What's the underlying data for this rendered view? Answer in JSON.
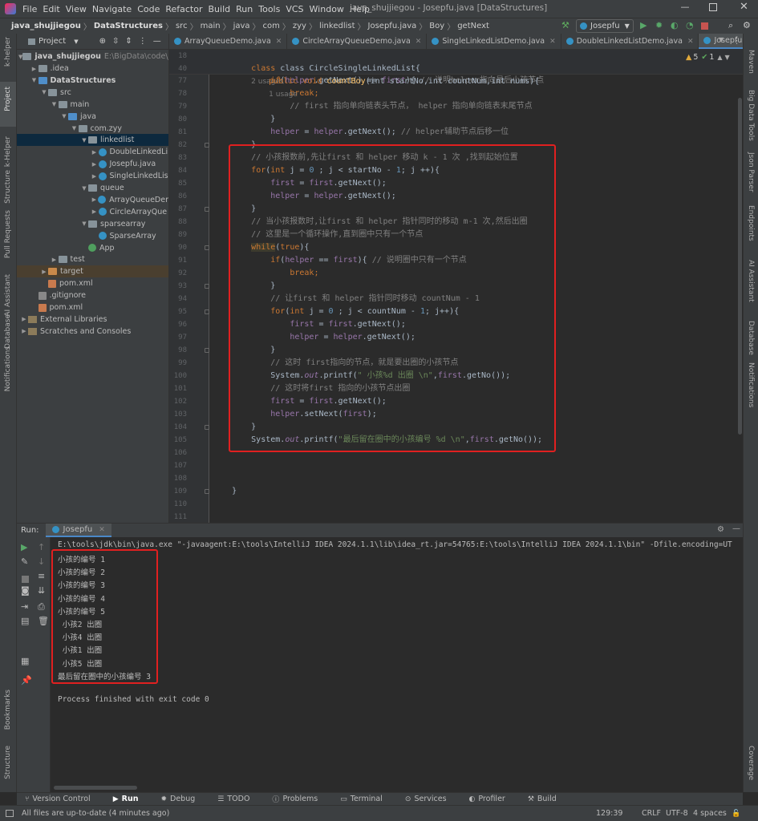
{
  "title_bar": {
    "menus": [
      "File",
      "Edit",
      "View",
      "Navigate",
      "Code",
      "Refactor",
      "Build",
      "Run",
      "Tools",
      "VCS",
      "Window",
      "Help"
    ],
    "title": "java_shujjiegou - Josepfu.java [DataStructures]"
  },
  "breadcrumb": [
    "java_shujjiegou",
    "DataStructures",
    "src",
    "main",
    "java",
    "com",
    "zyy",
    "linkedlist",
    "Josepfu.java",
    "Boy",
    "getNext"
  ],
  "run_config": "Josepfu",
  "left_strip": {
    "items": [
      "k-helper",
      "Project",
      "k-Helper",
      "Structure",
      "Pull Requests",
      "AI Assistant",
      "Database",
      "Notifications",
      "Bookmarks",
      "Structure"
    ]
  },
  "right_strip": {
    "items": [
      "Maven",
      "Big Data Tools",
      "Json Parser",
      "Endpoints",
      "AI Assistant",
      "Database",
      "Notifications",
      "Coverage"
    ]
  },
  "project_panel": {
    "title": "Project",
    "root": "java_shujjiegou",
    "root_path": "E:\\BigData\\code\\java",
    "tree": [
      {
        "label": ".idea",
        "depth": 1,
        "icon": "folder",
        "arrow": ">"
      },
      {
        "label": "DataStructures",
        "depth": 1,
        "icon": "folder-blue",
        "arrow": "v",
        "bold": true
      },
      {
        "label": "src",
        "depth": 2,
        "icon": "folder",
        "arrow": "v"
      },
      {
        "label": "main",
        "depth": 3,
        "icon": "folder",
        "arrow": "v"
      },
      {
        "label": "java",
        "depth": 4,
        "icon": "folder-blue",
        "arrow": "v"
      },
      {
        "label": "com.zyy",
        "depth": 5,
        "icon": "folder",
        "arrow": "v"
      },
      {
        "label": "linkedlist",
        "depth": 6,
        "icon": "folder",
        "arrow": "v",
        "selected": true
      },
      {
        "label": "DoubleLinkedLi",
        "depth": 7,
        "icon": "class",
        "arrow": ">"
      },
      {
        "label": "Josepfu.java",
        "depth": 7,
        "icon": "class",
        "arrow": ">"
      },
      {
        "label": "SingleLinkedLis",
        "depth": 7,
        "icon": "class",
        "arrow": ">"
      },
      {
        "label": "queue",
        "depth": 6,
        "icon": "folder",
        "arrow": "v"
      },
      {
        "label": "ArrayQueueDer",
        "depth": 7,
        "icon": "class",
        "arrow": ">"
      },
      {
        "label": "CircleArrayQue",
        "depth": 7,
        "icon": "class",
        "arrow": ">"
      },
      {
        "label": "sparsearray",
        "depth": 6,
        "icon": "folder",
        "arrow": "v"
      },
      {
        "label": "SparseArray",
        "depth": 7,
        "icon": "class",
        "arrow": ""
      },
      {
        "label": "App",
        "depth": 6,
        "icon": "class-green",
        "arrow": ""
      },
      {
        "label": "test",
        "depth": 3,
        "icon": "folder",
        "arrow": ">"
      },
      {
        "label": "target",
        "depth": 2,
        "icon": "folder-orange",
        "arrow": ">",
        "highlight": true
      },
      {
        "label": "pom.xml",
        "depth": 2,
        "icon": "xml",
        "arrow": ""
      },
      {
        "label": ".gitignore",
        "depth": 1,
        "icon": "git",
        "arrow": ""
      },
      {
        "label": "pom.xml",
        "depth": 1,
        "icon": "xml",
        "arrow": ""
      },
      {
        "label": "External Libraries",
        "depth": 0,
        "icon": "lib",
        "arrow": ">"
      },
      {
        "label": "Scratches and Consoles",
        "depth": 0,
        "icon": "scratch",
        "arrow": ">"
      }
    ]
  },
  "editor_tabs": [
    {
      "label": "ArrayQueueDemo.java"
    },
    {
      "label": "CircleArrayQueueDemo.java"
    },
    {
      "label": "SingleLinkedListDemo.java"
    },
    {
      "label": "DoubleLinkedListDemo.java"
    },
    {
      "label": "Josepfu.java",
      "active": true
    }
  ],
  "inspections": {
    "warnings": "5",
    "weak": "1"
  },
  "code": {
    "sticky1": {
      "ln": "18",
      "text": "class CircleSingleLinkedList{",
      "hint": "2 usages"
    },
    "sticky2": {
      "ln": "40",
      "kw1": "public void ",
      "name": "countBoy",
      "params": "(int startNo,int countNum,int nums){",
      "hint": "1 usage"
    },
    "lines": [
      {
        "ln": "77",
        "tokens": [
          {
            "t": "            ",
            "c": ""
          },
          {
            "t": "if",
            "c": "kw"
          },
          {
            "t": "(",
            "c": ""
          },
          {
            "t": "helper",
            "c": "fld"
          },
          {
            "t": ".getNext() == ",
            "c": ""
          },
          {
            "t": "first",
            "c": "fld"
          },
          {
            "t": "){ ",
            "c": ""
          },
          {
            "t": "// 说明helper指向最后小孩节点",
            "c": "cm"
          }
        ]
      },
      {
        "ln": "78",
        "tokens": [
          {
            "t": "                ",
            "c": ""
          },
          {
            "t": "break",
            "c": "kw"
          },
          {
            "t": ";",
            "c": "kw"
          }
        ]
      },
      {
        "ln": "79",
        "tokens": [
          {
            "t": "                ",
            "c": ""
          },
          {
            "t": "// first 指向单向链表头节点， helper 指向单向链表末尾节点",
            "c": "cm"
          }
        ]
      },
      {
        "ln": "80",
        "tokens": [
          {
            "t": "            }",
            "c": ""
          }
        ]
      },
      {
        "ln": "81",
        "tokens": [
          {
            "t": "            ",
            "c": ""
          },
          {
            "t": "helper",
            "c": "fld"
          },
          {
            "t": " = ",
            "c": ""
          },
          {
            "t": "helper",
            "c": "fld"
          },
          {
            "t": ".getNext(); ",
            "c": ""
          },
          {
            "t": "// helper辅助节点后移一位",
            "c": "cm"
          }
        ]
      },
      {
        "ln": "82",
        "tokens": [
          {
            "t": "        }",
            "c": ""
          }
        ]
      },
      {
        "ln": "83",
        "tokens": [
          {
            "t": "        ",
            "c": ""
          },
          {
            "t": "// 小孩报数前,先让first 和 helper 移动 k - 1 次 ,找到起始位置",
            "c": "cm"
          }
        ]
      },
      {
        "ln": "84",
        "tokens": [
          {
            "t": "        ",
            "c": ""
          },
          {
            "t": "for",
            "c": "kw"
          },
          {
            "t": "(",
            "c": ""
          },
          {
            "t": "int ",
            "c": "kw"
          },
          {
            "t": "j = ",
            "c": ""
          },
          {
            "t": "0",
            "c": "num"
          },
          {
            "t": " ; j < startNo - ",
            "c": ""
          },
          {
            "t": "1",
            "c": "num"
          },
          {
            "t": "; j ++){",
            "c": ""
          }
        ]
      },
      {
        "ln": "85",
        "tokens": [
          {
            "t": "            ",
            "c": ""
          },
          {
            "t": "first",
            "c": "fld"
          },
          {
            "t": " = ",
            "c": ""
          },
          {
            "t": "first",
            "c": "fld"
          },
          {
            "t": ".getNext();",
            "c": ""
          }
        ]
      },
      {
        "ln": "86",
        "tokens": [
          {
            "t": "            ",
            "c": ""
          },
          {
            "t": "helper",
            "c": "fld"
          },
          {
            "t": " = ",
            "c": ""
          },
          {
            "t": "helper",
            "c": "fld"
          },
          {
            "t": ".getNext();",
            "c": ""
          }
        ]
      },
      {
        "ln": "87",
        "tokens": [
          {
            "t": "        }",
            "c": ""
          }
        ]
      },
      {
        "ln": "88",
        "tokens": [
          {
            "t": "        ",
            "c": ""
          },
          {
            "t": "// 当小孩报数时,让first 和 helper 指针同时的移动 m-1 次,然后出圈",
            "c": "cm"
          }
        ]
      },
      {
        "ln": "89",
        "tokens": [
          {
            "t": "        ",
            "c": ""
          },
          {
            "t": "// 这里是一个循环操作,直到圈中只有一个节点",
            "c": "cm"
          }
        ]
      },
      {
        "ln": "90",
        "tokens": [
          {
            "t": "        ",
            "c": ""
          },
          {
            "t": "while",
            "c": "kw"
          },
          {
            "t": "(",
            "c": ""
          },
          {
            "t": "true",
            "c": "kw"
          },
          {
            "t": "){",
            "c": ""
          }
        ]
      },
      {
        "ln": "91",
        "tokens": [
          {
            "t": "            ",
            "c": ""
          },
          {
            "t": "if",
            "c": "kw"
          },
          {
            "t": "(",
            "c": ""
          },
          {
            "t": "helper",
            "c": "fld"
          },
          {
            "t": " == ",
            "c": ""
          },
          {
            "t": "first",
            "c": "fld"
          },
          {
            "t": "){ ",
            "c": ""
          },
          {
            "t": "// 说明圈中只有一个节点",
            "c": "cm"
          }
        ]
      },
      {
        "ln": "92",
        "tokens": [
          {
            "t": "                ",
            "c": ""
          },
          {
            "t": "break",
            "c": "kw"
          },
          {
            "t": ";",
            "c": "kw"
          }
        ]
      },
      {
        "ln": "93",
        "tokens": [
          {
            "t": "            }",
            "c": ""
          }
        ]
      },
      {
        "ln": "94",
        "tokens": [
          {
            "t": "            ",
            "c": ""
          },
          {
            "t": "// 让first 和 helper 指针同时移动 countNum - 1",
            "c": "cm"
          }
        ]
      },
      {
        "ln": "95",
        "tokens": [
          {
            "t": "            ",
            "c": ""
          },
          {
            "t": "for",
            "c": "kw"
          },
          {
            "t": "(",
            "c": ""
          },
          {
            "t": "int ",
            "c": "kw"
          },
          {
            "t": "j = ",
            "c": ""
          },
          {
            "t": "0",
            "c": "num"
          },
          {
            "t": " ; j < countNum - ",
            "c": ""
          },
          {
            "t": "1",
            "c": "num"
          },
          {
            "t": "; j++){",
            "c": ""
          }
        ]
      },
      {
        "ln": "96",
        "tokens": [
          {
            "t": "                ",
            "c": ""
          },
          {
            "t": "first",
            "c": "fld"
          },
          {
            "t": " = ",
            "c": ""
          },
          {
            "t": "first",
            "c": "fld"
          },
          {
            "t": ".getNext();",
            "c": ""
          }
        ]
      },
      {
        "ln": "97",
        "tokens": [
          {
            "t": "                ",
            "c": ""
          },
          {
            "t": "helper",
            "c": "fld"
          },
          {
            "t": " = ",
            "c": ""
          },
          {
            "t": "helper",
            "c": "fld"
          },
          {
            "t": ".getNext();",
            "c": ""
          }
        ]
      },
      {
        "ln": "98",
        "tokens": [
          {
            "t": "            }",
            "c": ""
          }
        ]
      },
      {
        "ln": "99",
        "tokens": [
          {
            "t": "            ",
            "c": ""
          },
          {
            "t": "// 这时 first指向的节点，就是要出圈的小孩节点",
            "c": "cm"
          }
        ]
      },
      {
        "ln": "100",
        "tokens": [
          {
            "t": "            System.",
            "c": ""
          },
          {
            "t": "out",
            "c": "it"
          },
          {
            "t": ".printf(",
            "c": ""
          },
          {
            "t": "\" 小孩%d 出圈 \\n\"",
            "c": "str"
          },
          {
            "t": ",",
            "c": ""
          },
          {
            "t": "first",
            "c": "fld"
          },
          {
            "t": ".getNo());",
            "c": ""
          }
        ]
      },
      {
        "ln": "101",
        "tokens": [
          {
            "t": "            ",
            "c": ""
          },
          {
            "t": "// 这时将first 指向的小孩节点出圈",
            "c": "cm"
          }
        ]
      },
      {
        "ln": "102",
        "tokens": [
          {
            "t": "            ",
            "c": ""
          },
          {
            "t": "first",
            "c": "fld"
          },
          {
            "t": " = ",
            "c": ""
          },
          {
            "t": "first",
            "c": "fld"
          },
          {
            "t": ".getNext();",
            "c": ""
          }
        ]
      },
      {
        "ln": "103",
        "tokens": [
          {
            "t": "            ",
            "c": ""
          },
          {
            "t": "helper",
            "c": "fld"
          },
          {
            "t": ".setNext(",
            "c": ""
          },
          {
            "t": "first",
            "c": "fld"
          },
          {
            "t": ");",
            "c": ""
          }
        ]
      },
      {
        "ln": "104",
        "tokens": [
          {
            "t": "        }",
            "c": ""
          }
        ]
      },
      {
        "ln": "105",
        "tokens": [
          {
            "t": "        System.",
            "c": ""
          },
          {
            "t": "out",
            "c": "it"
          },
          {
            "t": ".printf(",
            "c": ""
          },
          {
            "t": "\"最后留在圈中的小孩编号 %d \\n\"",
            "c": "str"
          },
          {
            "t": ",",
            "c": ""
          },
          {
            "t": "first",
            "c": "fld"
          },
          {
            "t": ".getNo());",
            "c": ""
          }
        ]
      },
      {
        "ln": "106",
        "tokens": []
      },
      {
        "ln": "107",
        "tokens": []
      },
      {
        "ln": "108",
        "tokens": []
      },
      {
        "ln": "109",
        "tokens": [
          {
            "t": "    }",
            "c": ""
          }
        ]
      },
      {
        "ln": "110",
        "tokens": []
      },
      {
        "ln": "111",
        "tokens": []
      }
    ]
  },
  "run_panel": {
    "label": "Run:",
    "tab": "Josepfu",
    "command": "E:\\tools\\jdk\\bin\\java.exe \"-javaagent:E:\\tools\\IntelliJ IDEA 2024.1.1\\lib\\idea_rt.jar=54765:E:\\tools\\IntelliJ IDEA 2024.1.1\\bin\" -Dfile.encoding=UT",
    "output": [
      "小孩的编号 1",
      "小孩的编号 2",
      "小孩的编号 3",
      "小孩的编号 4",
      "小孩的编号 5",
      " 小孩2 出圈",
      " 小孩4 出圈",
      " 小孩1 出圈",
      " 小孩5 出圈",
      "最后留在圈中的小孩编号 3"
    ],
    "exit": "Process finished with exit code 0"
  },
  "bottom_tools": [
    "Version Control",
    "Run",
    "Debug",
    "TODO",
    "Problems",
    "Terminal",
    "Services",
    "Profiler",
    "Build"
  ],
  "status": {
    "message": "All files are up-to-date (4 minutes ago)",
    "position": "129:39",
    "line_sep": "CRLF",
    "encoding": "UTF-8",
    "indent": "4 spaces"
  }
}
